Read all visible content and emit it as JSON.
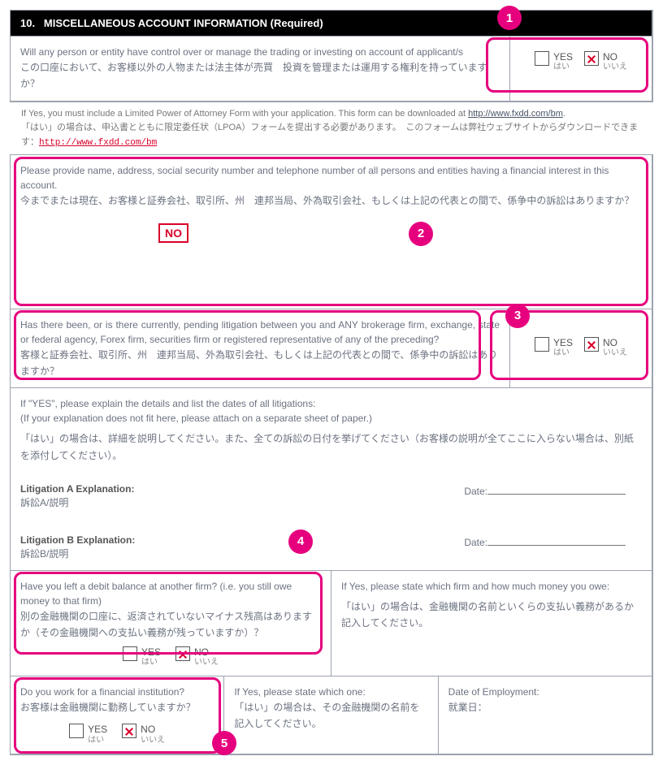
{
  "header": {
    "number": "10.",
    "title_en": "MISCELLANEOUS ACCOUNT INFORMATION (Required)"
  },
  "badges": [
    "1",
    "2",
    "3",
    "4",
    "5"
  ],
  "yn": {
    "yes_en": "YES",
    "yes_jp": "はい",
    "no_en": "NO",
    "no_jp": "いいえ"
  },
  "q1": {
    "en": "Will any person or entity have control over or manage the trading or investing on account of applicant/s",
    "jp": "この口座において、お客様以外の人物または法主体が売買　投資を管理または運用する権利を持っていますか？"
  },
  "note1": {
    "en_pre": "If Yes, you must include a Limited Power of Attorney Form with your application.  This form can be downloaded at ",
    "en_link": "http://www.fxdd.com/bm",
    "en_post": ".",
    "jp_pre": "「はい」の場合は、申込書とともに限定委任状（LPOA）フォームを提出する必要があります。　このフォームは弊社ウェブサイトからダウンロードできます：",
    "jp_link": "http://www.fxdd.com/bm"
  },
  "q2": {
    "en": "Please provide name, address, social security number and telephone number of all persons and entities having a financial interest in this account.",
    "jp": "今までまたは現在、お客様と証券会社、取引所、州　連邦当局、外為取引会社、もしくは上記の代表との間で、係争中の訴訟はありますか？",
    "stamp": "NO"
  },
  "q3": {
    "en": "Has there been, or is there currently, pending litigation between you and ANY brokerage firm, exchange, state or federal agency, Forex firm, securities firm or registered representative of any of the preceding?",
    "jp": "客様と証券会社、取引所、州　連邦当局、外為取引会社、もしくは上記の代表との間で、係争中の訴訟はありますか？"
  },
  "lit": {
    "intro_en": "If \"YES\", please explain the details and list the dates of all litigations:",
    "intro_en2": "(If your explanation does not fit here, please attach on a separate sheet of paper.)",
    "intro_jp": "「はい」の場合は、詳細を説明してください。また、全ての訴訟の日付を挙げてください（お客様の説明が全てここに入らない場合は、別紙を添付してください）。",
    "a_en": "Litigation A Explanation:",
    "a_jp": "訴訟A/説明",
    "b_en": "Litigation B Explanation:",
    "b_jp": "訴訟B/説明",
    "date_label": "Date:"
  },
  "q4": {
    "left_en": "Have you left a debit balance at another firm? (i.e. you still owe money to that firm)",
    "left_jp": "別の金融機関の口座に、返済されていないマイナス残高はありますか（その金融機関への支払い義務が残っていますか）？",
    "right_en": "If Yes, please state which firm and how much money you owe:",
    "right_jp": "「はい」の場合は、金融機関の名前といくらの支払い義務があるか記入してください。"
  },
  "q5": {
    "c1_en": "Do you work for a financial institution?",
    "c1_jp": "お客様は金融機関に勤務していますか？",
    "c2_en": "If Yes, please state which one:",
    "c2_jp": "「はい」の場合は、その金融機関の名前を記入してください。",
    "c3_en": "Date of Employment:",
    "c3_jp": "就業日："
  }
}
